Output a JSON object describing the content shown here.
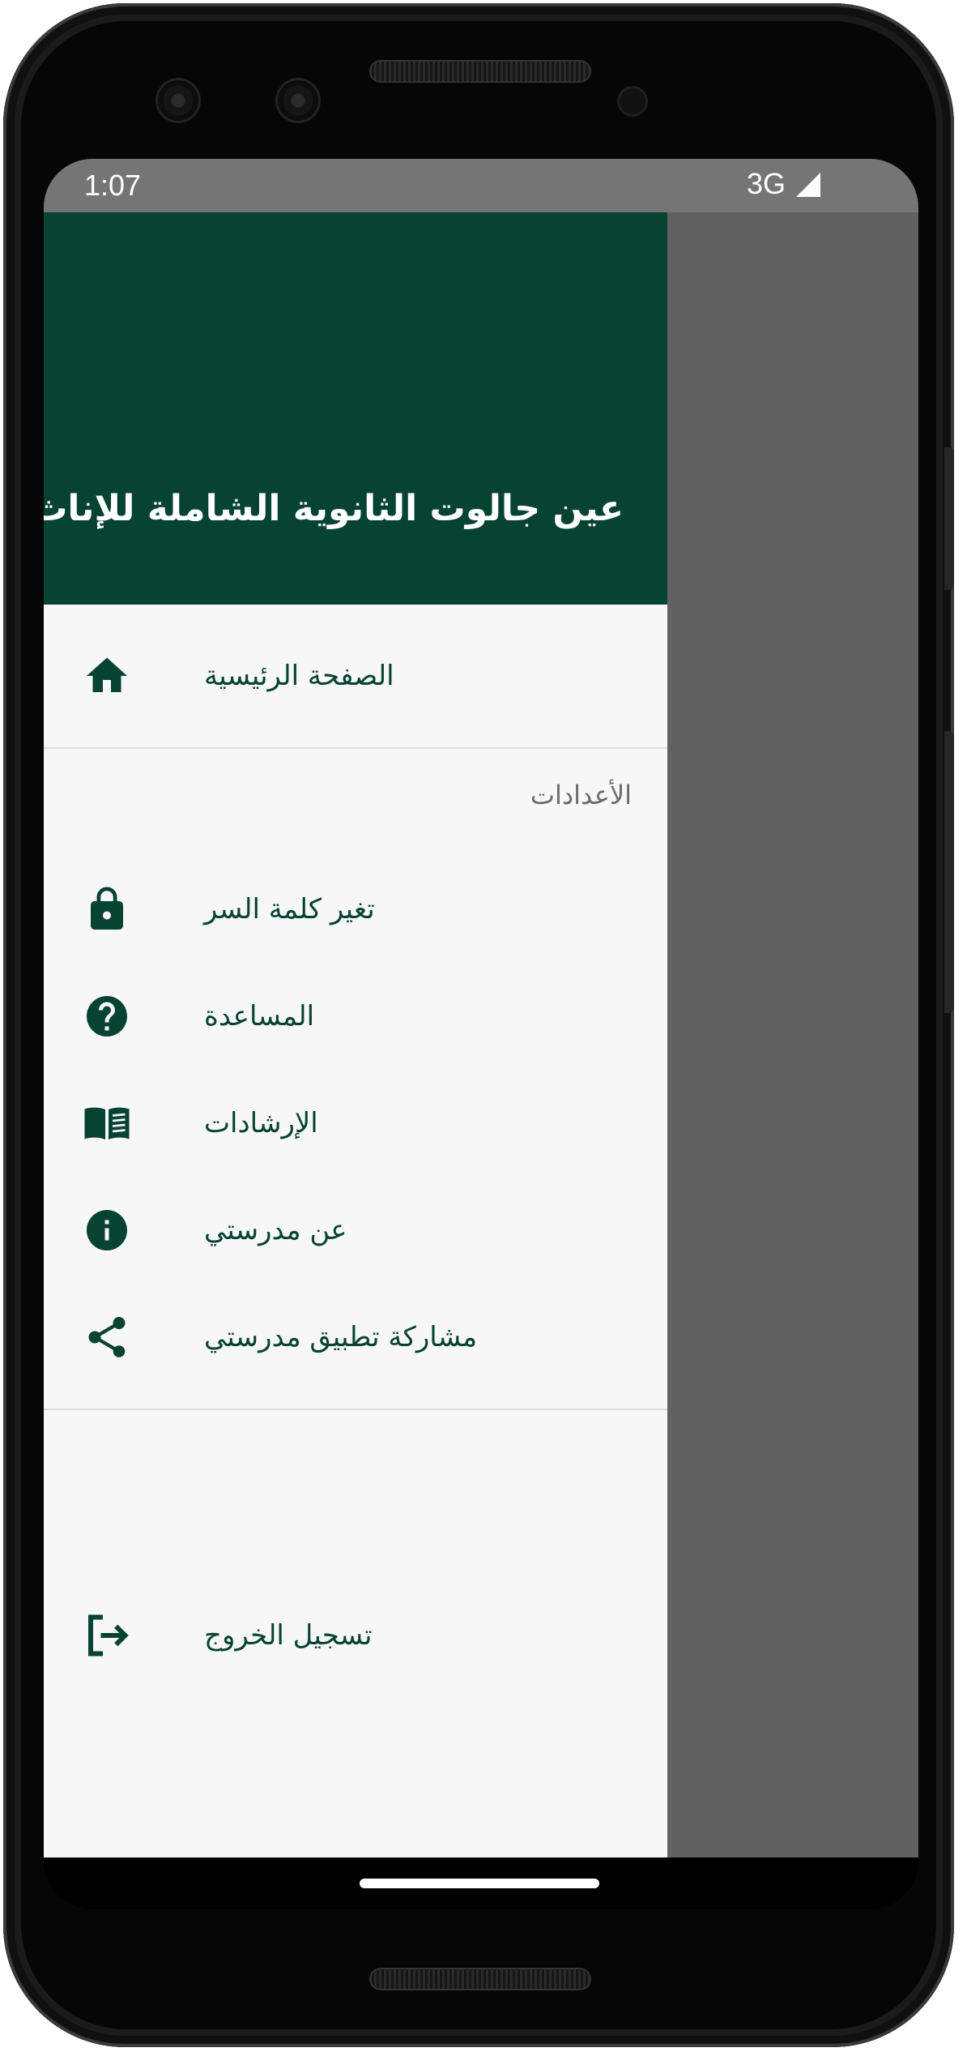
{
  "status_bar": {
    "time": "1:07",
    "network": "3G"
  },
  "drawer": {
    "title": "عين جالوت الثانوية الشاملة للإناث",
    "home_label": "الصفحة الرئيسية",
    "settings_header": "الأعدادات",
    "items": [
      {
        "label": "تغير كلمة السر",
        "icon": "lock-icon"
      },
      {
        "label": "المساعدة",
        "icon": "help-icon"
      },
      {
        "label": "الإرشادات",
        "icon": "book-icon"
      },
      {
        "label": "عن مدرستي",
        "icon": "info-icon"
      },
      {
        "label": "مشاركة تطبيق مدرستي",
        "icon": "share-icon"
      }
    ],
    "logout_label": "تسجيل الخروج"
  },
  "colors": {
    "primary": "#074331",
    "scrim": "#616161",
    "status_bar": "#757575",
    "drawer_bg": "#f7f7f7"
  }
}
